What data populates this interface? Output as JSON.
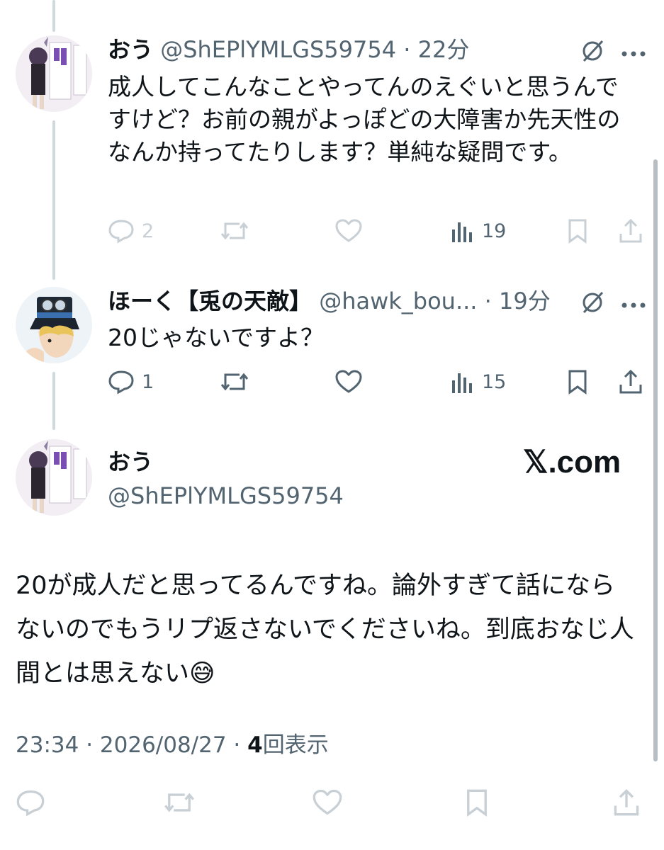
{
  "tweets": [
    {
      "name": "おう",
      "handle": "@ShEPlYMLGS59754",
      "time": "22分",
      "text": "成人してこんなことやってんのえぐいと思うんですけど？お前の親がよっぽどの大障害か先天性のなんか持ってたりします？単純な疑問です。",
      "replies": "2",
      "views": "19"
    },
    {
      "name": "ほーく【兎の天敵】",
      "handle": "@hawk_bou...",
      "time": "19分",
      "text": "20じゃないですよ？",
      "replies": "1",
      "views": "15"
    }
  ],
  "main_tweet": {
    "name": "おう",
    "handle": "@ShEPlYMLGS59754",
    "brand": "𝕏.com",
    "text": "20が成人だと思ってるんですね。論外すぎて話にならないのでもうリプ返さないでくださいね。到底おなじ人間とは思えない😅",
    "timestamp": "23:34 · 2026/08/27 · ",
    "views_count": "4",
    "views_label": "回表示"
  },
  "separator": "·",
  "colors": {
    "text": "#0f1419",
    "secondary": "#536471",
    "faint": "#c8d0d6",
    "thread_line": "#cfd9de"
  },
  "icons": [
    "grok-icon",
    "more-icon",
    "reply-icon",
    "retweet-icon",
    "like-icon",
    "views-icon",
    "bookmark-icon",
    "share-icon"
  ]
}
